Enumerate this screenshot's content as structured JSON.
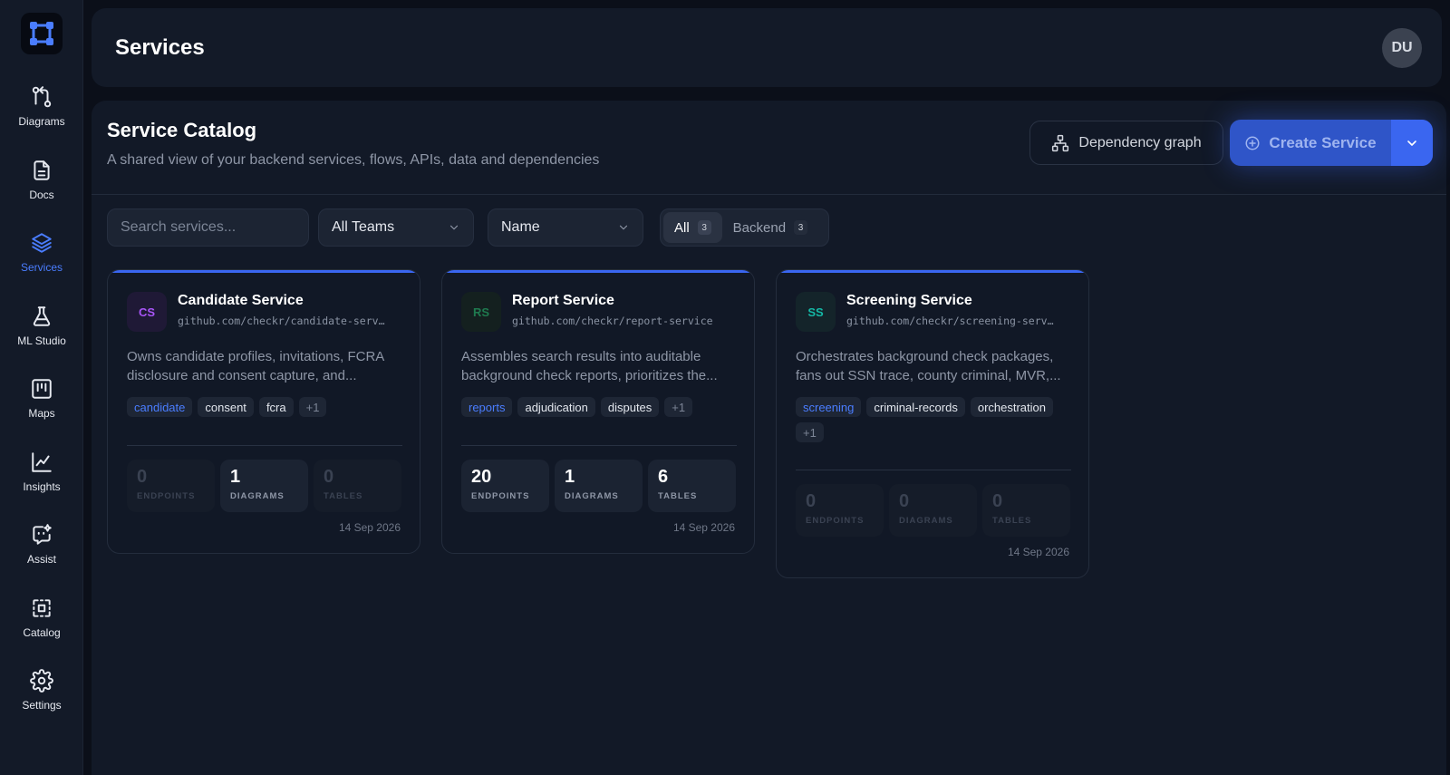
{
  "sidebar": {
    "logo": "app-logo",
    "items": [
      {
        "label": "Diagrams",
        "icon": "diagrams-icon",
        "active": false
      },
      {
        "label": "Docs",
        "icon": "docs-icon",
        "active": false
      },
      {
        "label": "Services",
        "icon": "layers-icon",
        "active": true
      },
      {
        "label": "ML Studio",
        "icon": "flask-icon",
        "active": false
      },
      {
        "label": "Maps",
        "icon": "map-icon",
        "active": false
      },
      {
        "label": "Insights",
        "icon": "chart-icon",
        "active": false
      },
      {
        "label": "Assist",
        "icon": "assist-icon",
        "active": false
      },
      {
        "label": "Catalog",
        "icon": "catalog-icon",
        "active": false
      },
      {
        "label": "Settings",
        "icon": "gear-icon",
        "active": false
      }
    ]
  },
  "header": {
    "title": "Services",
    "avatar_initials": "DU"
  },
  "catalog": {
    "title": "Service Catalog",
    "subtitle": "A shared view of your backend services, flows, APIs, data and dependencies",
    "dependency_button": "Dependency graph",
    "create_button": "Create Service"
  },
  "filters": {
    "search_placeholder": "Search services...",
    "team_select": "All Teams",
    "sort_select": "Name",
    "segments": [
      {
        "label": "All",
        "count": "3",
        "active": true
      },
      {
        "label": "Backend",
        "count": "3",
        "active": false
      }
    ]
  },
  "services": [
    {
      "initials": "CS",
      "badge_color": "#a855f7",
      "badge_bg": "#1f1936",
      "name": "Candidate Service",
      "repo": "github.com/checkr/candidate-service",
      "description": "Owns candidate profiles, invitations, FCRA disclosure and consent capture, and...",
      "primary_tag": "candidate",
      "tags": [
        "consent",
        "fcra"
      ],
      "more": "+1",
      "endpoints": "0",
      "diagrams": "1",
      "tables": "0",
      "date": "14 Sep 2026"
    },
    {
      "initials": "RS",
      "badge_color": "#1f7a4f",
      "badge_bg": "#14201f",
      "name": "Report Service",
      "repo": "github.com/checkr/report-service",
      "description": "Assembles search results into auditable background check reports, prioritizes the...",
      "primary_tag": "reports",
      "tags": [
        "adjudication",
        "disputes"
      ],
      "more": "+1",
      "endpoints": "20",
      "diagrams": "1",
      "tables": "6",
      "date": "14 Sep 2026"
    },
    {
      "initials": "SS",
      "badge_color": "#14b8a6",
      "badge_bg": "#14242a",
      "name": "Screening Service",
      "repo": "github.com/checkr/screening-service",
      "description": "Orchestrates background check packages, fans out SSN trace, county criminal, MVR,...",
      "primary_tag": "screening",
      "tags": [
        "criminal-records",
        "orchestration"
      ],
      "more": "+1",
      "endpoints": "0",
      "diagrams": "0",
      "tables": "0",
      "date": "14 Sep 2026"
    }
  ],
  "stat_labels": {
    "endpoints": "ENDPOINTS",
    "diagrams": "DIAGRAMS",
    "tables": "TABLES"
  },
  "colors": {
    "accent": "#3a66f0",
    "active_nav": "#4a7dff"
  }
}
